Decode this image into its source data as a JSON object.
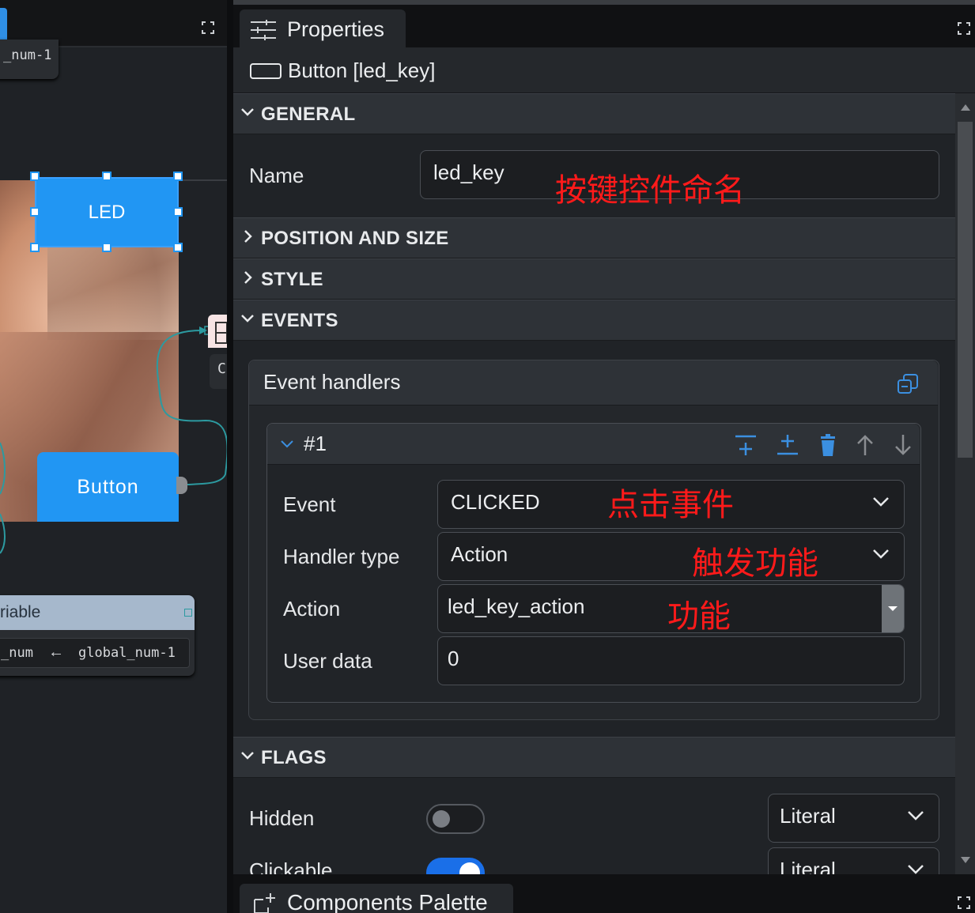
{
  "canvas": {
    "top_node_label": "_num-1",
    "led_button_label": "LED",
    "button_label": "Button",
    "right_node_text": "C",
    "variable_node": {
      "title": "riable",
      "left_var": "_num",
      "arrow": "←",
      "right_var": "global_num-1"
    }
  },
  "properties": {
    "tab_label": "Properties",
    "object_title": "Button [led_key]",
    "sections": {
      "general": "GENERAL",
      "position": "POSITION AND SIZE",
      "style": "STYLE",
      "events": "EVENTS",
      "flags": "FLAGS"
    },
    "general": {
      "name_label": "Name",
      "name_value": "led_key",
      "name_annotation": "按键控件命名"
    },
    "events": {
      "handlers_title": "Event handlers",
      "handler_label": "#1",
      "event_label": "Event",
      "event_value": "CLICKED",
      "event_annotation": "点击事件",
      "handler_type_label": "Handler type",
      "handler_type_value": "Action",
      "handler_type_annotation": "触发功能",
      "action_label": "Action",
      "action_value": "led_key_action",
      "action_annotation": "功能",
      "user_data_label": "User data",
      "user_data_value": "0"
    },
    "flags": {
      "hidden_label": "Hidden",
      "hidden_on": false,
      "hidden_mode": "Literal",
      "clickable_label": "Clickable",
      "clickable_on": true,
      "clickable_mode": "Literal"
    }
  },
  "palette": {
    "tab_label": "Components Palette"
  },
  "colors": {
    "accent": "#2196f3",
    "annotation": "#ff1a1a",
    "toggle_on": "#1a6fe8"
  }
}
